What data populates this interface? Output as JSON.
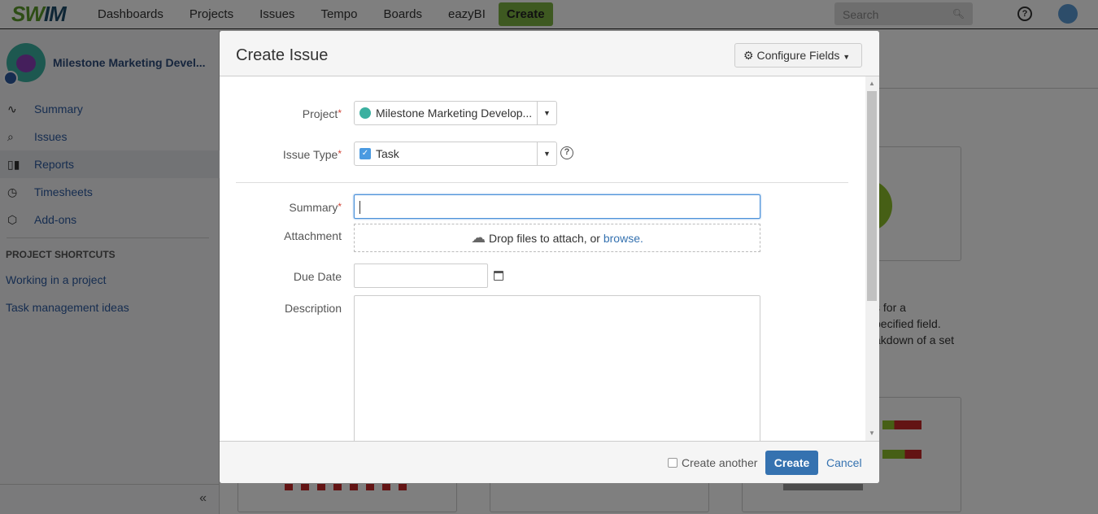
{
  "topbar": {
    "logo": "SWIM",
    "nav": [
      "Dashboards",
      "Projects",
      "Issues",
      "Tempo",
      "Boards",
      "eazyBI"
    ],
    "create": "Create",
    "search_placeholder": "Search"
  },
  "sidebar": {
    "project_name": "Milestone Marketing Devel...",
    "items": [
      {
        "label": "Summary",
        "icon": "activity-icon"
      },
      {
        "label": "Issues",
        "icon": "issues-search-icon"
      },
      {
        "label": "Reports",
        "icon": "bar-chart-icon",
        "active": true
      },
      {
        "label": "Timesheets",
        "icon": "clock-icon"
      },
      {
        "label": "Add-ons",
        "icon": "hexagon-icon"
      }
    ],
    "shortcuts_heading": "PROJECT SHORTCUTS",
    "shortcuts": [
      "Working in a project",
      "Task management ideas"
    ],
    "collapse": "«"
  },
  "background": {
    "text_lines": [
      "s for a",
      "pecified field.",
      "akdown of a set"
    ]
  },
  "modal": {
    "title": "Create Issue",
    "configure_fields": "Configure Fields",
    "fields": {
      "project_label": "Project",
      "project_value": "Milestone Marketing Develop...",
      "issue_type_label": "Issue Type",
      "issue_type_value": "Task",
      "summary_label": "Summary",
      "summary_value": "",
      "attachment_label": "Attachment",
      "attachment_text": "Drop files to attach, or",
      "attachment_link": "browse.",
      "due_date_label": "Due Date",
      "due_date_value": "",
      "description_label": "Description",
      "description_value": ""
    },
    "required_mark": "*",
    "footer": {
      "create_another": "Create another",
      "create_another_checked": false,
      "create": "Create",
      "cancel": "Cancel"
    }
  },
  "colors": {
    "primary": "#3572b0",
    "create_nav": "#7cb342",
    "required": "#d04437"
  }
}
